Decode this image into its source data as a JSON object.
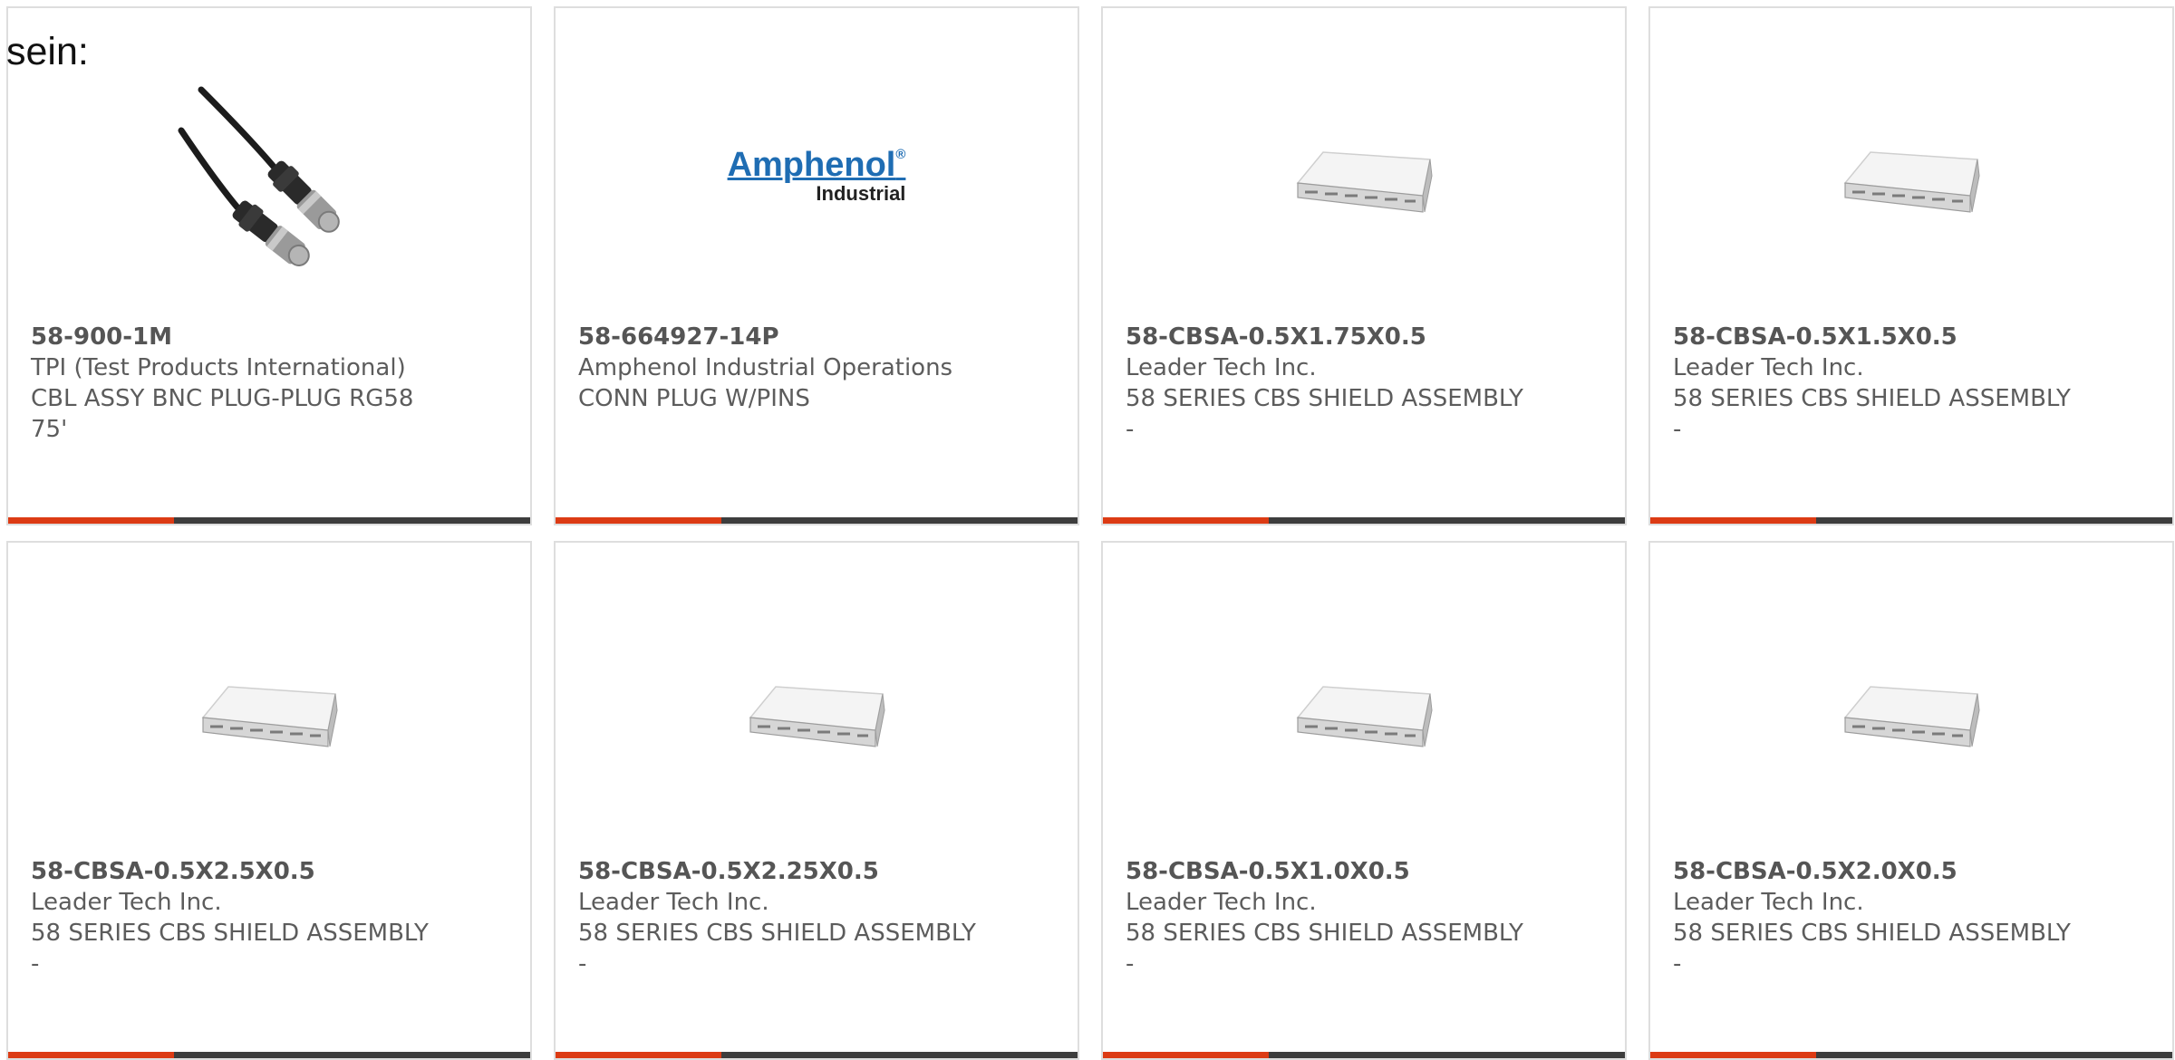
{
  "intro_text": "sein:",
  "products": [
    {
      "part": "58-900-1M",
      "maker": "TPI (Test Products International)",
      "desc": "CBL ASSY BNC PLUG-PLUG RG58 75'",
      "image": "bnc-cable-image"
    },
    {
      "part": "58-664927-14P",
      "maker": "Amphenol Industrial Operations",
      "desc": "CONN PLUG W/PINS",
      "image": "amphenol-logo",
      "logo_text": [
        "Amphenol",
        "Industrial"
      ]
    },
    {
      "part": "58-CBSA-0.5X1.75X0.5",
      "maker": "Leader Tech Inc.",
      "desc": "58 SERIES CBS SHIELD ASSEMBLY -",
      "image": "shield-image"
    },
    {
      "part": "58-CBSA-0.5X1.5X0.5",
      "maker": "Leader Tech Inc.",
      "desc": "58 SERIES CBS SHIELD ASSEMBLY -",
      "image": "shield-image"
    },
    {
      "part": "58-CBSA-0.5X2.5X0.5",
      "maker": "Leader Tech Inc.",
      "desc": "58 SERIES CBS SHIELD ASSEMBLY -",
      "image": "shield-image"
    },
    {
      "part": "58-CBSA-0.5X2.25X0.5",
      "maker": "Leader Tech Inc.",
      "desc": "58 SERIES CBS SHIELD ASSEMBLY -",
      "image": "shield-image"
    },
    {
      "part": "58-CBSA-0.5X1.0X0.5",
      "maker": "Leader Tech Inc.",
      "desc": "58 SERIES CBS SHIELD ASSEMBLY -",
      "image": "shield-image"
    },
    {
      "part": "58-CBSA-0.5X2.0X0.5",
      "maker": "Leader Tech Inc.",
      "desc": "58 SERIES CBS SHIELD ASSEMBLY -",
      "image": "shield-image"
    }
  ],
  "colors": {
    "accent": "#dc3b14",
    "bar": "#3d3d3d",
    "border": "#dedede",
    "text": "#5c5c5c",
    "brand_blue": "#1f6db3"
  }
}
